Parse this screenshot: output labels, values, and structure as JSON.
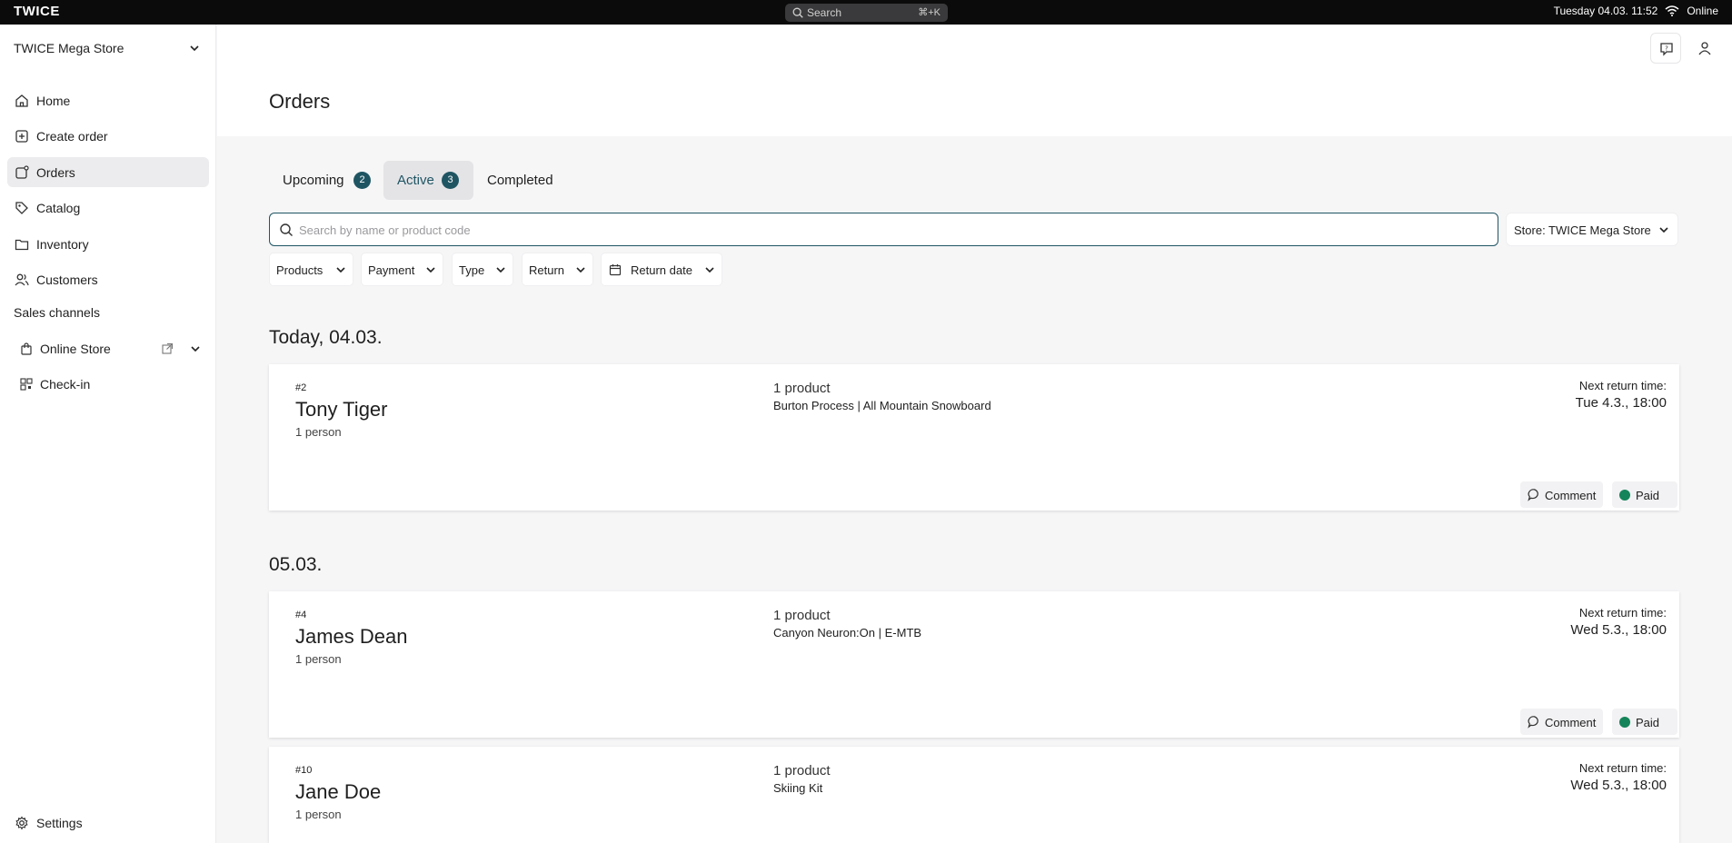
{
  "topbar": {
    "logo": "TWICE",
    "search_label": "Search",
    "search_shortcut": "⌘+K",
    "datetime": "Tuesday 04.03. 11:52",
    "status": "Online"
  },
  "sidebar": {
    "store_name": "TWICE Mega Store",
    "items": [
      {
        "label": "Home",
        "icon": "home-icon"
      },
      {
        "label": "Create order",
        "icon": "plus-square-icon"
      },
      {
        "label": "Orders",
        "icon": "orders-icon"
      },
      {
        "label": "Catalog",
        "icon": "tag-icon"
      },
      {
        "label": "Inventory",
        "icon": "folder-icon"
      },
      {
        "label": "Customers",
        "icon": "users-icon"
      }
    ],
    "active_item": "Orders",
    "sales_channels_label": "Sales channels",
    "channels": [
      {
        "label": "Online Store",
        "icon": "shopping-bag-icon"
      },
      {
        "label": "Check-in",
        "icon": "qr-code-icon"
      }
    ],
    "settings_label": "Settings"
  },
  "main": {
    "title": "Orders",
    "tabs": [
      {
        "label": "Upcoming",
        "count": "2"
      },
      {
        "label": "Active",
        "count": "3"
      },
      {
        "label": "Completed"
      }
    ],
    "active_tab": "Active",
    "search_placeholder": "Search by name or product code",
    "store_filter": "Store: TWICE Mega Store",
    "filters": [
      "Products",
      "Payment",
      "Type",
      "Return",
      "Return date"
    ]
  },
  "groups": [
    {
      "heading": "Today, 04.03.",
      "orders": [
        {
          "number": "#2",
          "name": "Tony Tiger",
          "persons": "1 person",
          "product_count": "1 product",
          "product": "Burton Process | All Mountain Snowboard",
          "return_label": "Next return time:",
          "return_time": "Tue 4.3., 18:00",
          "comment": "Comment",
          "payment": "Paid"
        }
      ]
    },
    {
      "heading": "05.03.",
      "orders": [
        {
          "number": "#4",
          "name": "James Dean",
          "persons": "1 person",
          "product_count": "1 product",
          "product": "Canyon Neuron:On | E-MTB",
          "return_label": "Next return time:",
          "return_time": "Wed 5.3., 18:00",
          "comment": "Comment",
          "payment": "Paid"
        },
        {
          "number": "#10",
          "name": "Jane Doe",
          "persons": "1 person",
          "product_count": "1 product",
          "product": "Skiing Kit",
          "return_label": "Next return time:",
          "return_time": "Wed 5.3., 18:00"
        }
      ]
    }
  ],
  "colors": {
    "accent": "#1f5563",
    "paid_dot": "#15845a",
    "topbar_bg": "#0b0b0b",
    "active_nav_bg": "#ececee"
  }
}
